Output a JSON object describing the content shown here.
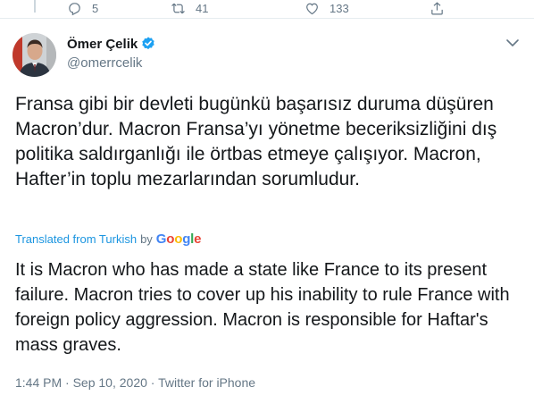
{
  "previous_tweet": {
    "actions": {
      "reply_count": "5",
      "retweet_count": "41",
      "like_count": "133"
    }
  },
  "tweet": {
    "author": {
      "display_name": "Ömer Çelik",
      "handle": "@omerrcelik",
      "verified": true
    },
    "text": "Fransa gibi bir devleti bugünkü başarısız duruma düşüren Macron’dur. Macron Fransa’yı yönetme beceriksizliğini dış politika saldırganlığı ile örtbas etmeye çalışıyor. Macron, Hafter’in toplu mezarlarından sorumludur.",
    "translation": {
      "label": "Translated from Turkish",
      "by": "by",
      "provider": {
        "letter_1": "G",
        "letter_2": "o",
        "letter_3": "o",
        "letter_4": "g",
        "letter_5": "l",
        "letter_6": "e"
      },
      "text": "It is Macron who has made a state like France to its present failure. Macron tries to cover up his inability to rule France with foreign policy aggression. Macron is responsible for Haftar's mass graves."
    },
    "meta": {
      "time": "1:44 PM",
      "separator_1": " · ",
      "date": "Sep 10, 2020",
      "separator_2": " · ",
      "source": "Twitter for iPhone"
    }
  },
  "icons": {
    "reply": "reply-icon",
    "retweet": "retweet-icon",
    "like": "heart-icon",
    "share": "share-icon",
    "verified": "verified-badge-icon",
    "more": "chevron-down-icon"
  },
  "colors": {
    "link_blue": "#1b95e0",
    "secondary_text": "#657786",
    "primary_text": "#14171a",
    "verified_blue": "#1da1f2",
    "divider": "#e6ecf0"
  }
}
